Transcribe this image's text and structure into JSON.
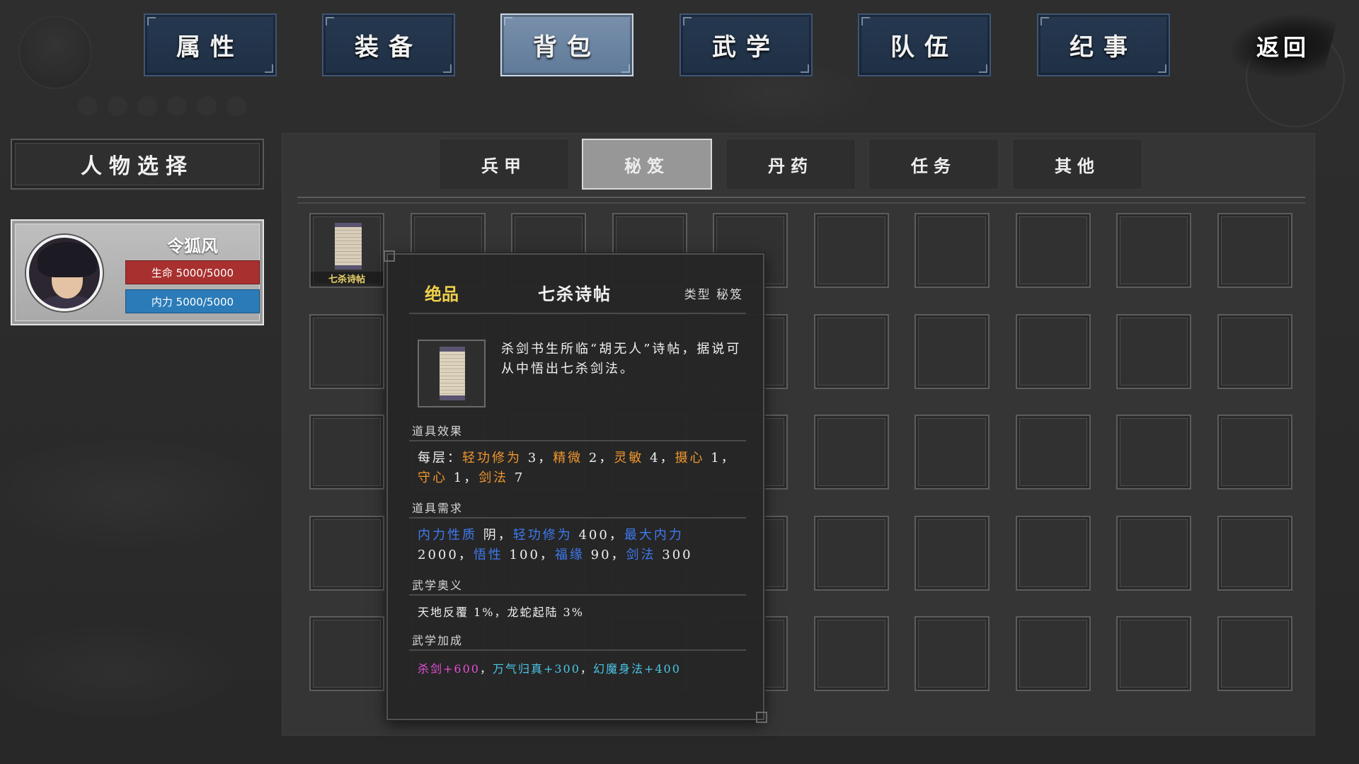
{
  "top_nav": {
    "tabs": [
      {
        "label": "属性",
        "active": false
      },
      {
        "label": "装备",
        "active": false
      },
      {
        "label": "背包",
        "active": true
      },
      {
        "label": "武学",
        "active": false
      },
      {
        "label": "队伍",
        "active": false
      },
      {
        "label": "纪事",
        "active": false
      }
    ],
    "back_label": "返回"
  },
  "left_panel": {
    "select_label": "人物选择",
    "character": {
      "name": "令狐风",
      "hp_text": "生命 5000/5000",
      "mp_text": "内力 5000/5000"
    }
  },
  "inventory": {
    "sub_tabs": [
      {
        "label": "兵甲",
        "active": false
      },
      {
        "label": "秘笈",
        "active": true
      },
      {
        "label": "丹药",
        "active": false
      },
      {
        "label": "任务",
        "active": false
      },
      {
        "label": "其他",
        "active": false
      }
    ],
    "rows": 5,
    "cols": 10,
    "first_item": {
      "name": "七杀诗帖",
      "icon": "scroll-icon"
    }
  },
  "tooltip": {
    "quality": "绝品",
    "name": "七杀诗帖",
    "type": "类型 秘笈",
    "description": "杀剑书生所临“胡无人”诗帖，据说可从中悟出七杀剑法。",
    "effect_title": "道具效果",
    "effect_prefix": "每层：",
    "effect_items": [
      {
        "name": "轻功修为",
        "value": "3"
      },
      {
        "name": "精微",
        "value": "2"
      },
      {
        "name": "灵敏",
        "value": "4"
      },
      {
        "name": "摄心",
        "value": "1"
      },
      {
        "name": "守心",
        "value": "1"
      },
      {
        "name": "剑法",
        "value": "7"
      }
    ],
    "req_title": "道具需求",
    "req_items": [
      {
        "name": "内力性质",
        "value": "阴"
      },
      {
        "name": "轻功修为",
        "value": "400"
      },
      {
        "name": "最大内力",
        "value": "2000"
      },
      {
        "name": "悟性",
        "value": "100"
      },
      {
        "name": "福缘",
        "value": "90"
      },
      {
        "name": "剑法",
        "value": "300"
      }
    ],
    "mystery_title": "武学奥义",
    "mystery_text": "天地反覆 1%，龙蛇起陆 3%",
    "bonus_title": "武学加成",
    "bonus_items": [
      {
        "text": "杀剑+600",
        "color": "#e64fd6"
      },
      {
        "text": "万气归真+300",
        "color": "#4ac6e8"
      },
      {
        "text": "幻魔身法+400",
        "color": "#4ac6e8"
      }
    ]
  },
  "colors": {
    "tab_bg": "#26384f",
    "tab_active_bg": "#7990ab",
    "hp_bar": "#a8302e",
    "mp_bar": "#2b7bb8",
    "quality_gold": "#f0d04a",
    "attr_orange": "#f0962e",
    "req_blue": "#3f7af0"
  }
}
